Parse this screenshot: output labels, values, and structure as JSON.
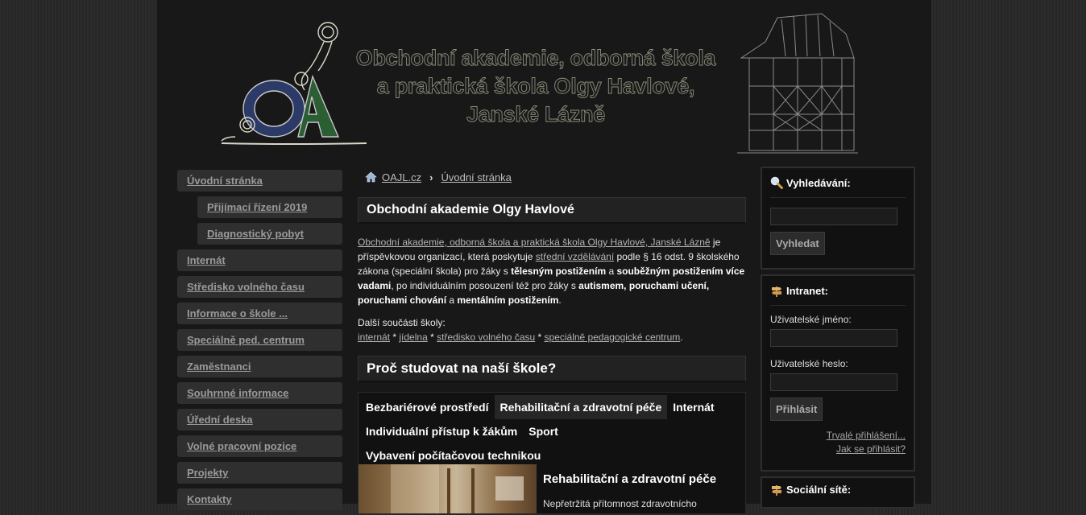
{
  "header": {
    "title_lines": [
      "Obchodní akademie, odborná škola",
      "a praktická škola Olgy Havlové,",
      "Janské Lázně"
    ]
  },
  "nav": {
    "items": [
      {
        "label": "Úvodní stránka"
      },
      {
        "label": "Přijímací řízení 2019"
      },
      {
        "label": "Diagnostický pobyt"
      },
      {
        "label": "Internát"
      },
      {
        "label": "Středisko volného času"
      },
      {
        "label": "Informace o škole ..."
      },
      {
        "label": "Speciálně ped. centrum"
      },
      {
        "label": "Zaměstnanci"
      },
      {
        "label": "Souhrnné informace"
      },
      {
        "label": "Úřední deska"
      },
      {
        "label": "Volné pracovní pozice"
      },
      {
        "label": "Projekty"
      },
      {
        "label": "Kontakty"
      }
    ]
  },
  "breadcrumb": {
    "home": "OAJL.cz",
    "current": "Úvodní stránka"
  },
  "main": {
    "heading": "Obchodní akademie Olgy Havlové",
    "intro": {
      "link_school": "Obchodní akademie, odborná škola a praktická škola Olgy Havlové, Janské Lázně",
      "t1": " je příspěvkovou organizací, která poskytuje ",
      "link_edu": "střední vzdělávání",
      "t2": " podle § 16 odst. 9 školského zákona (speciální škola) pro žáky s ",
      "b1": "tělesným postižením",
      "t3": " a ",
      "b2": "souběžným postižením více vadami",
      "t4": ", po individuálním posouzení též pro žáky s ",
      "b3": "autismem, poruchami učení, poruchami chování",
      "t5": " a ",
      "b4": "mentálním postižením",
      "t6": "."
    },
    "parts": {
      "label": "Další součásti školy:",
      "links": [
        "internát",
        "jídelna",
        "středisko volného času",
        "speciálně pedagogické centrum"
      ],
      "sep": " * ",
      "end": "."
    },
    "why_heading": "Proč studovat na naší škole?",
    "tabs": [
      "Bezbariérové prostředí",
      "Rehabilitační a zdravotní péče",
      "Internát",
      "Individuální přístup k žákům",
      "Sport",
      "Vybavení počítačovou technikou"
    ],
    "slide_title": "Rehabilitační a zdravotní péče",
    "slide_text": "Nepřetržitá přítomnost zdravotnícho"
  },
  "right": {
    "search": {
      "title": "Vyhledávání:",
      "button": "Vyhledat"
    },
    "intranet": {
      "title": "Intranet:",
      "user_label": "Uživatelské jméno:",
      "pass_label": "Uživatelské heslo:",
      "button": "Přihlásit",
      "link_persist": "Trvalé přihlášení...",
      "link_how": "Jak se přihlásit?"
    },
    "social": {
      "title": "Sociální sítě:"
    }
  },
  "colors": {
    "page_bg": "#181818",
    "accent_green": "#2f6b3a",
    "accent_blue": "#2e3f6e"
  }
}
